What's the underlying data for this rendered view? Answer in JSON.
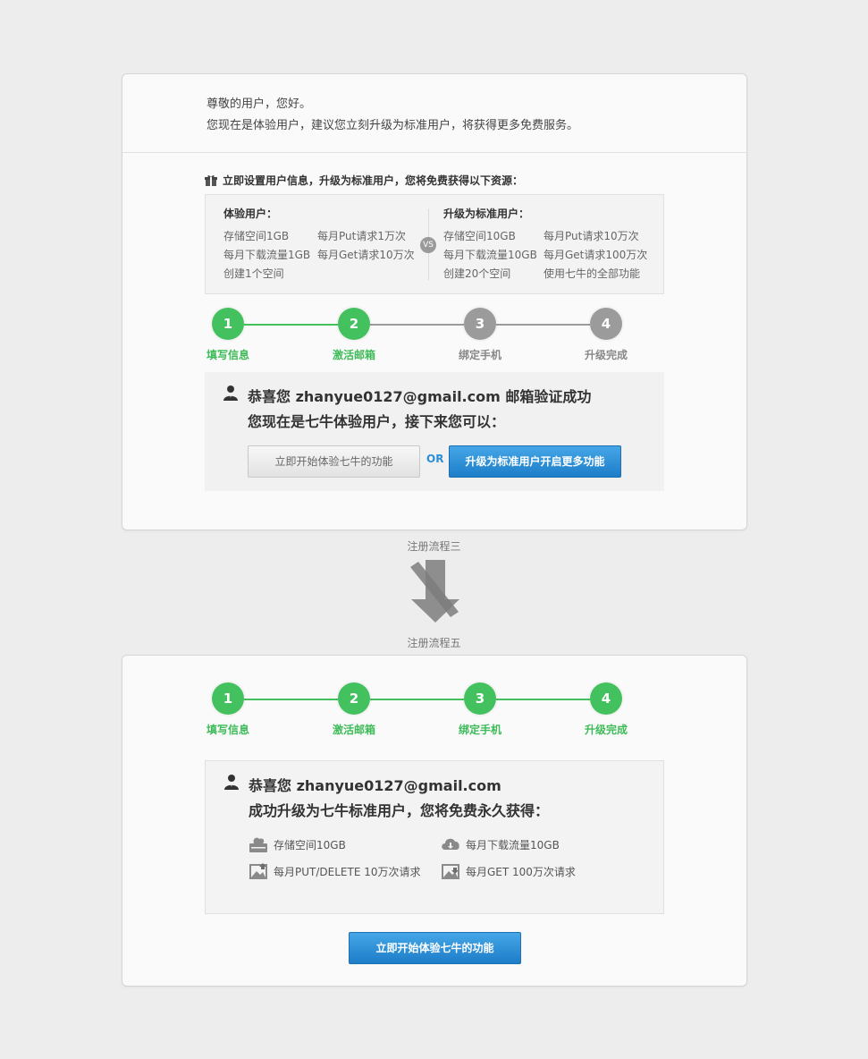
{
  "greeting": {
    "line1": "尊敬的用户，您好。",
    "line2": "您现在是体验用户，建议您立刻升级为标准用户，将获得更多免费服务。"
  },
  "promo": {
    "title": "立即设置用户信息，升级为标准用户，您将免费获得以下资源：",
    "icon": "gift-icon"
  },
  "compare": {
    "vs": "VS",
    "trial": {
      "heading": "体验用户：",
      "items": [
        "存储空间1GB",
        "每月Put请求1万次",
        "每月下载流量1GB",
        "每月Get请求10万次",
        "创建1个空间"
      ]
    },
    "standard": {
      "heading": "升级为标准用户：",
      "items": [
        "存储空间10GB",
        "每月Put请求10万次",
        "每月下载流量10GB",
        "每月Get请求100万次",
        "创建20个空间",
        "使用七牛的全部功能"
      ]
    }
  },
  "steps": [
    {
      "num": "1",
      "label": "填写信息"
    },
    {
      "num": "2",
      "label": "激活邮箱"
    },
    {
      "num": "3",
      "label": "绑定手机"
    },
    {
      "num": "4",
      "label": "升级完成"
    }
  ],
  "step_progress": {
    "card1_completed": 2,
    "card2_completed": 4,
    "active_color": "#43c15e",
    "inactive_color": "#9b9b9b"
  },
  "card1_success": {
    "line1": "恭喜您 zhanyue0127@gmail.com 邮箱验证成功",
    "line2": "您现在是七牛体验用户，接下来您可以：",
    "start_button": "立即开始体验七牛的功能",
    "or": "OR",
    "upgrade_button": "升级为标准用户开启更多功能"
  },
  "flow": {
    "from": "注册流程三",
    "to": "注册流程五"
  },
  "card2_success": {
    "line1": "恭喜您 zhanyue0127@gmail.com",
    "line2": "成功升级为七牛标准用户，您将免费永久获得：",
    "benefits": [
      {
        "icon": "storage-icon",
        "text": "存储空间10GB"
      },
      {
        "icon": "cloud-download-icon",
        "text": "每月下载流量10GB"
      },
      {
        "icon": "image-upload-icon",
        "text": "每月PUT/DELETE 10万次请求"
      },
      {
        "icon": "image-download-icon",
        "text": "每月GET 100万次请求"
      }
    ],
    "start_button": "立即开始体验七牛的功能"
  }
}
